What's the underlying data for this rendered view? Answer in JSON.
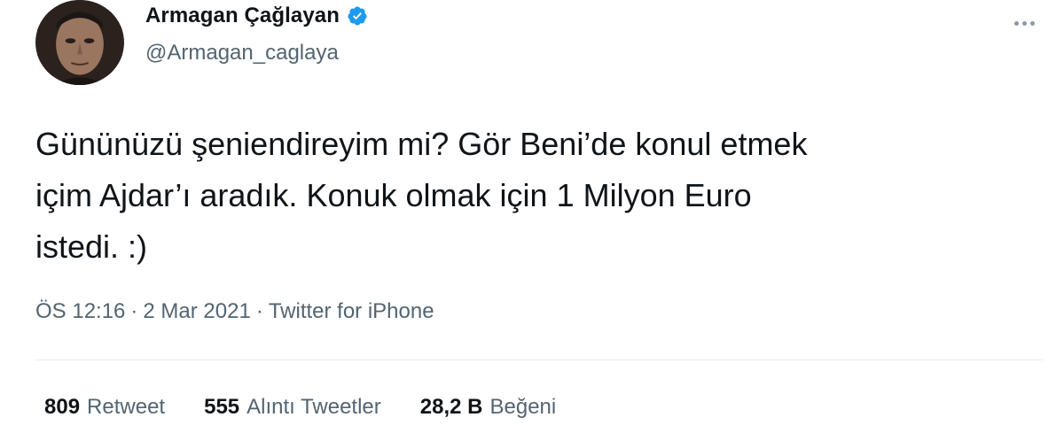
{
  "user": {
    "display_name": "Armagan Çağlayan",
    "handle": "@Armagan_caglaya",
    "verified_icon": "verified-badge-icon",
    "verified_color": "#1d9bf0"
  },
  "tweet": {
    "text": "Gününüzü şeniendireyim mi? Gör Beni’de konul etmek\niçim Ajdar’ı aradık. Konuk olmak için 1 Milyon Euro\nistedi. :)"
  },
  "meta": {
    "time": "ÖS 12:16",
    "date": "2 Mar 2021",
    "separator": "·",
    "source": "Twitter for iPhone"
  },
  "stats": {
    "retweets_count": "809",
    "retweets_label": "Retweet",
    "quotes_count": "555",
    "quotes_label": "Alıntı Tweetler",
    "likes_count": "28,2 B",
    "likes_label": "Beğeni"
  },
  "more_icon": "more-horizontal-icon"
}
